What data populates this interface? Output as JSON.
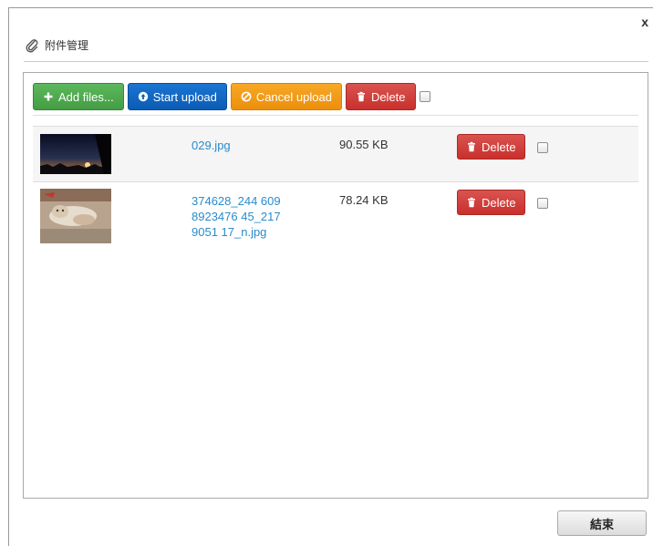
{
  "dialog": {
    "title": "附件管理",
    "close_label": "x",
    "finish_label": "結束"
  },
  "toolbar": {
    "add_files_label": "Add files...",
    "start_upload_label": "Start upload",
    "cancel_upload_label": "Cancel upload",
    "delete_label": "Delete"
  },
  "files": [
    {
      "name": "029.jpg",
      "size": "90.55 KB",
      "delete_label": "Delete"
    },
    {
      "name": "374628_244 6098923476 45_2179051 17_n.jpg",
      "size": "78.24 KB",
      "delete_label": "Delete"
    }
  ],
  "colors": {
    "green": "#5cb85c",
    "blue": "#1a75d2",
    "orange": "#f7a826",
    "red": "#d9534f",
    "link": "#2a8bcc"
  },
  "icons": [
    "paperclip-icon",
    "plus-icon",
    "upload-circle-icon",
    "ban-icon",
    "trash-icon",
    "close-icon"
  ]
}
